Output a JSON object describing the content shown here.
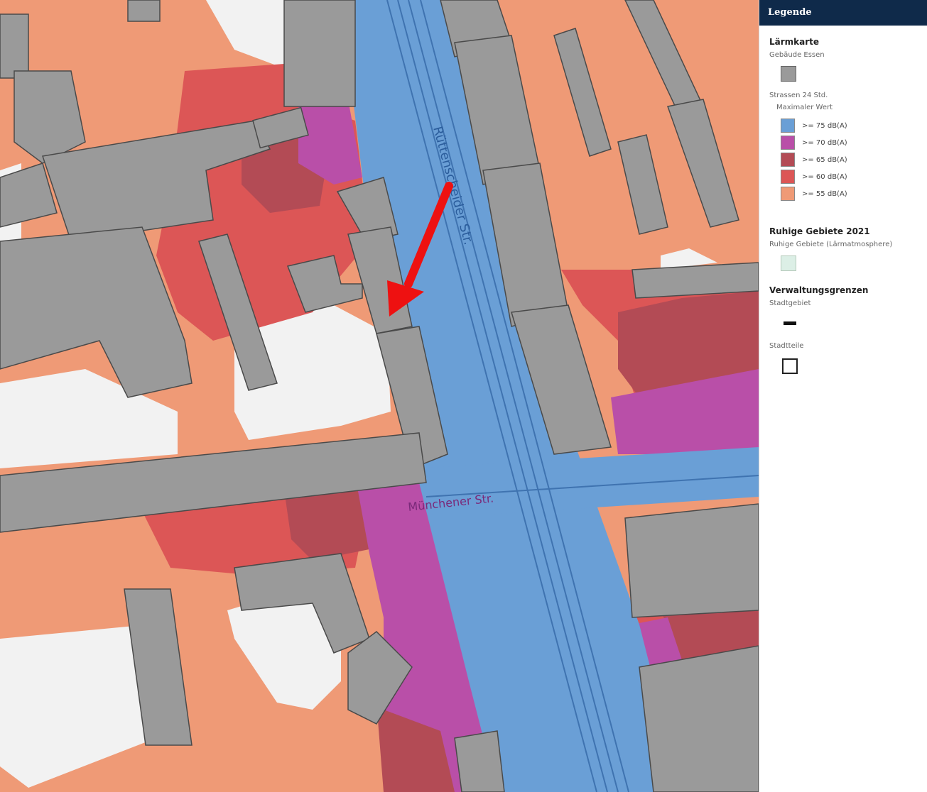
{
  "legend": {
    "header": "Legende",
    "laerm": {
      "title": "Lärmkarte",
      "buildings_label": "Gebäude Essen",
      "road_label": "Strassen 24 Std.",
      "max_label": "Maximaler Wert",
      "classes": [
        {
          "label": ">= 75 dB(A)",
          "color": "#6a9fd6"
        },
        {
          "label": ">= 70 dB(A)",
          "color": "#b94fa8"
        },
        {
          "label": ">= 65 dB(A)",
          "color": "#b34b55"
        },
        {
          "label": ">= 60 dB(A)",
          "color": "#dc5656"
        },
        {
          "label": ">= 55 dB(A)",
          "color": "#ef9a76"
        }
      ]
    },
    "ruhige": {
      "title": "Ruhige Gebiete 2021",
      "label": "Ruhige Gebiete (Lärmatmosphere)"
    },
    "verwaltung": {
      "title": "Verwaltungsgrenzen",
      "city_label": "Stadtgebiet",
      "district_label": "Stadtteile"
    }
  },
  "map": {
    "street_labels": [
      "Rüttenscheider Str.",
      "Münchener Str."
    ],
    "colors": {
      "level_55": "#ef9a76",
      "level_60": "#dc5656",
      "level_65": "#b34b55",
      "level_70": "#b94fa8",
      "level_75": "#6a9fd6",
      "building": "#9a9a9a",
      "building_stroke": "#4a4a4a",
      "quiet_white": "#f2f2f2",
      "arrow": "#ee1111"
    }
  }
}
